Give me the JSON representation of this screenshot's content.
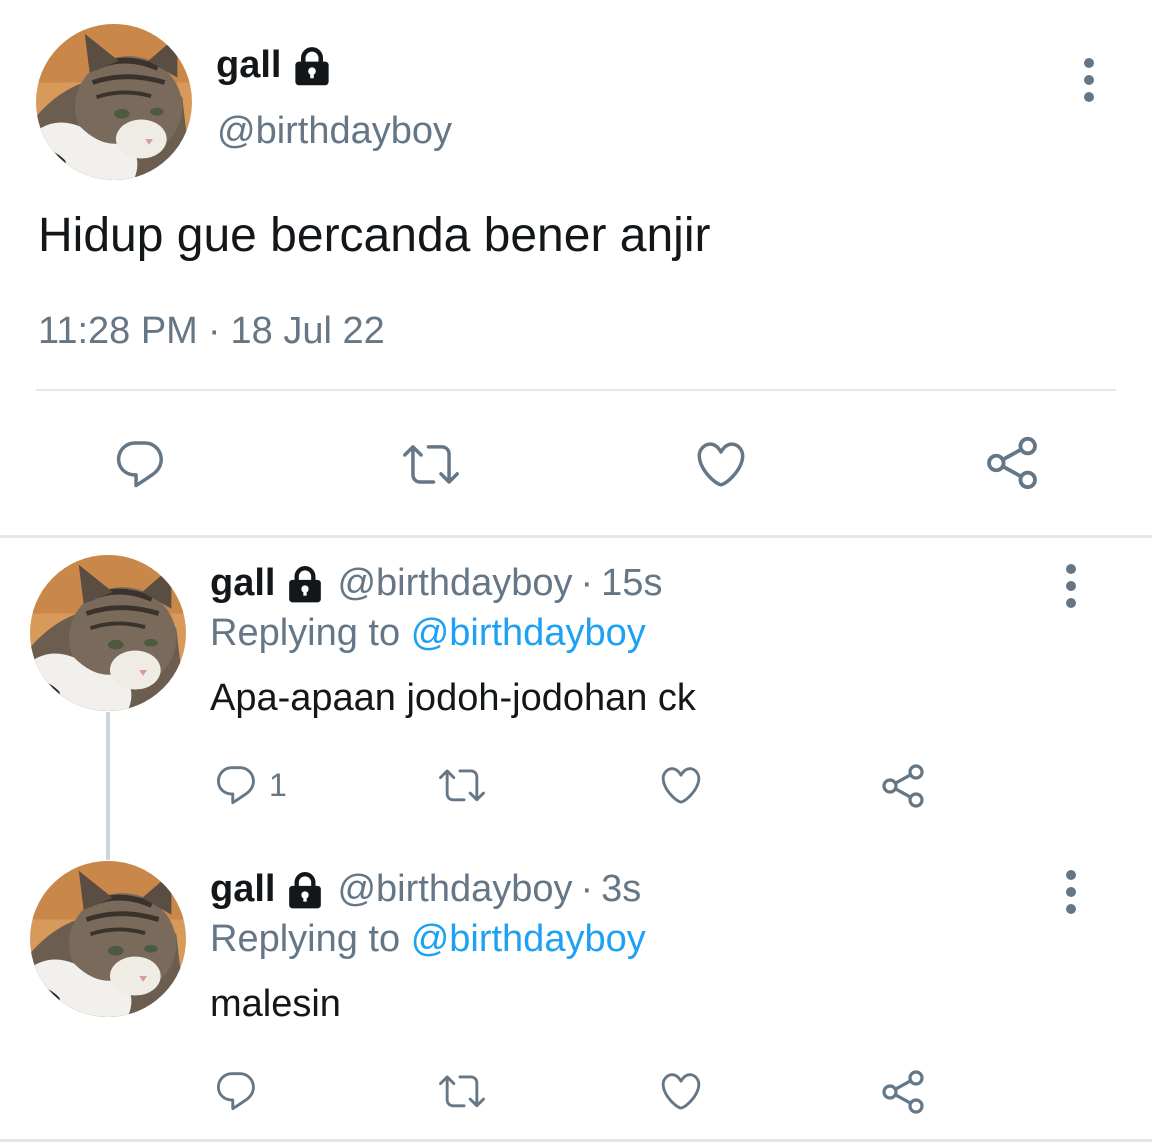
{
  "main_tweet": {
    "display_name": "gall",
    "handle": "@birthdayboy",
    "text": "Hidup gue bercanda bener anjir",
    "time": "11:28 PM",
    "separator": "·",
    "date": "18 Jul 22",
    "icons": {
      "protected": "lock-icon",
      "more": "more-vertical-icon",
      "reply": "reply-icon",
      "retweet": "retweet-icon",
      "like": "heart-icon",
      "share": "share-icon"
    }
  },
  "replies": [
    {
      "display_name": "gall",
      "handle": "@birthdayboy",
      "dot": "·",
      "time": "15s",
      "replying_label": "Replying to",
      "replying_to": "@birthdayboy",
      "text": "Apa-apaan jodoh-jodohan ck",
      "reply_count": "1"
    },
    {
      "display_name": "gall",
      "handle": "@birthdayboy",
      "dot": "·",
      "time": "3s",
      "replying_label": "Replying to",
      "replying_to": "@birthdayboy",
      "text": "malesin",
      "reply_count": ""
    }
  ],
  "colors": {
    "text_primary": "#14171a",
    "text_secondary": "#657786",
    "link": "#1da1f2",
    "divider": "#e1e8ed",
    "thread_line": "#ccd6dd"
  }
}
